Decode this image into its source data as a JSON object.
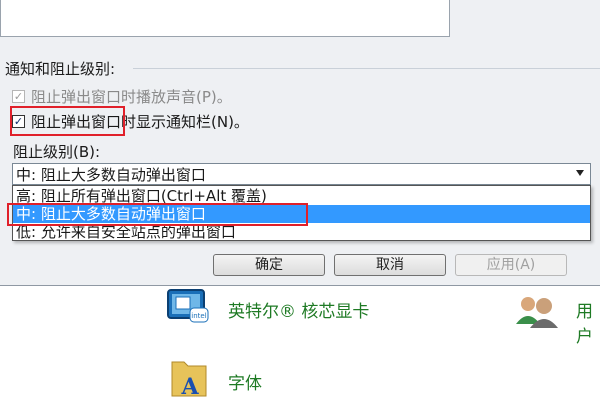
{
  "dialog": {
    "group_title": "通知和阻止级别:",
    "checkbox_sound": {
      "label": "阻止弹出窗口时播放声音(P)。",
      "checked": true,
      "enabled": false
    },
    "checkbox_notify": {
      "label": "阻止弹出窗口时显示通知栏(N)。",
      "checked": true,
      "enabled": true
    },
    "block_level_label": "阻止级别(B):",
    "combo_value": "中: 阻止大多数自动弹出窗口",
    "options": [
      "高: 阻止所有弹出窗口(Ctrl+Alt 覆盖)",
      "中: 阻止大多数自动弹出窗口",
      "低: 允许来自安全站点的弹出窗口"
    ],
    "selected_index": 1,
    "buttons": {
      "ok": "确定",
      "cancel": "取消",
      "apply": "应用(A)"
    }
  },
  "control_panel": {
    "items": [
      {
        "label": "英特尔® 核芯显卡",
        "icon": "intel-graphics-icon"
      },
      {
        "label": "用户",
        "icon": "user-accounts-icon"
      },
      {
        "label": "字体",
        "icon": "fonts-folder-icon"
      }
    ]
  },
  "colors": {
    "highlight": "#3399ff",
    "annotation": "#e0202a",
    "link_green": "#1e7a24"
  }
}
